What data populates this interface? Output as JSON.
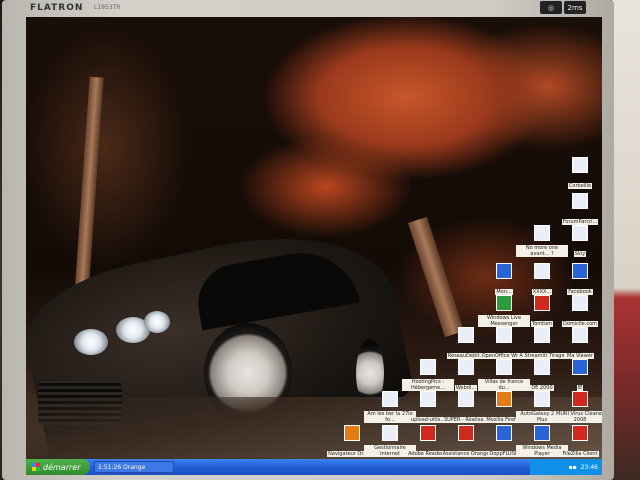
{
  "monitor": {
    "brand": "FLATRON",
    "model": "L1953TR",
    "badge1": "",
    "badge2": "2ms"
  },
  "desktop_icons": [
    {
      "label": "Corbeille",
      "color": "#eaeef7"
    },
    {
      "label": "ForumParcri...",
      "color": "#eaeef7"
    },
    {
      "label": "No more one avant... ?",
      "color": "#eaeef7"
    },
    {
      "label": "Skiy",
      "color": "#eaeef7"
    },
    {
      "label": "Mon...",
      "color": "#2a64d6"
    },
    {
      "label": "XXXX...",
      "color": "#eaeef7"
    },
    {
      "label": "Facebook",
      "color": "#2a64d6"
    },
    {
      "label": "Windows Live Messenger",
      "color": "#eaeef7"
    },
    {
      "label": "Tomtom",
      "color": "#d0291f"
    },
    {
      "label": "Domicile.com",
      "color": "#eaeef7"
    },
    {
      "label": "RéseauDébit...",
      "color": "#eaeef7"
    },
    {
      "label": "OpenOffice Writer",
      "color": "#eaeef7"
    },
    {
      "label": "A Streamlit Tirage",
      "color": "#eaeef7"
    },
    {
      "label": "Ma Viewer",
      "color": "#eaeef7"
    },
    {
      "label": "HostingPics - Hébergeme...",
      "color": "#eaeef7"
    },
    {
      "label": "Webdi...",
      "color": "#eaeef7"
    },
    {
      "label": "Villas de france du...",
      "color": "#eaeef7"
    },
    {
      "label": "DE 2000",
      "color": "#eaeef7"
    },
    {
      "label": "IE",
      "color": "#2a64d6"
    },
    {
      "label": "Am les ber la 27le fo...",
      "color": "#eaeef7"
    },
    {
      "label": "upload-utils...",
      "color": "#eaeef7"
    },
    {
      "label": "SUPER - Réalisa...",
      "color": "#eaeef7"
    },
    {
      "label": "Mozilla Firefox",
      "color": "#e57b14"
    },
    {
      "label": "AutoGalaxy 2008 Plus",
      "color": "#eaeef7"
    },
    {
      "label": "MURI Virus Cleaner 2008",
      "color": "#d0291f"
    },
    {
      "label": "Navigateur Orange",
      "color": "#e57b14"
    },
    {
      "label": "Gestionnaire Internet",
      "color": "#eaeef7"
    },
    {
      "label": "Adobe Reader 8",
      "color": "#d0291f"
    },
    {
      "label": "Assistance Orange",
      "color": "#d0291f"
    },
    {
      "label": "DoppFLUSH",
      "color": "#2a64d6"
    },
    {
      "label": "Windows Media Player",
      "color": "#2a64d6"
    },
    {
      "label": "FileZilla Client",
      "color": "#d0291f"
    }
  ],
  "taskbar": {
    "start_label": "démarrer",
    "task_button": "1:51:26 Orange",
    "language": "FR",
    "clock": "23:46"
  }
}
